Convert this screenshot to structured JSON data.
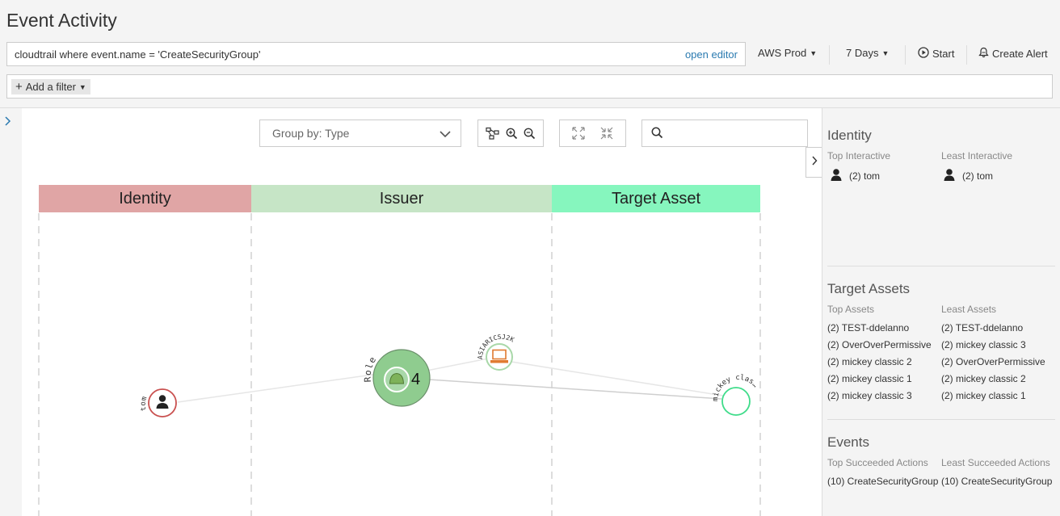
{
  "page_title": "Event Activity",
  "query": {
    "text": "cloudtrail where event.name = 'CreateSecurityGroup'",
    "open_editor": "open editor"
  },
  "toolbar": {
    "account": "AWS Prod",
    "range": "7 Days",
    "start": "Start",
    "create_alert": "Create Alert"
  },
  "filter": {
    "add_label": "Add a filter"
  },
  "graph_controls": {
    "groupby_label": "Group by: Type"
  },
  "columns": [
    {
      "label": "Identity",
      "color": "#e0a5a5"
    },
    {
      "label": "Issuer",
      "color": "#c6e5c6"
    },
    {
      "label": "Target Asset",
      "color": "#86f6be"
    }
  ],
  "nodes": {
    "tom": {
      "label": "tom"
    },
    "role": {
      "label": "Role",
      "count": "4"
    },
    "asia": {
      "label": "ASIARICSJ2K"
    },
    "mickey": {
      "label": "mickey clas…"
    }
  },
  "panel": {
    "identity": {
      "title": "Identity",
      "top_label": "Top Interactive",
      "least_label": "Least Interactive",
      "top": [
        "(2) tom"
      ],
      "least": [
        "(2) tom"
      ]
    },
    "targets": {
      "title": "Target Assets",
      "top_label": "Top Assets",
      "least_label": "Least Assets",
      "top": [
        "(2) TEST-ddelanno",
        "(2) OverOverPermissive",
        "(2) mickey classic 2",
        "(2) mickey classic 1",
        "(2) mickey classic 3"
      ],
      "least": [
        "(2) TEST-ddelanno",
        "(2) mickey classic 3",
        "(2) OverOverPermissive",
        "(2) mickey classic 2",
        "(2) mickey classic 1"
      ]
    },
    "events": {
      "title": "Events",
      "top_label": "Top Succeeded Actions",
      "least_label": "Least Succeeded Actions",
      "top": [
        "(10) CreateSecurityGroup"
      ],
      "least": [
        "(10) CreateSecurityGroup"
      ]
    }
  },
  "colors": {
    "link": "#2a7ab0",
    "identity_node": "#c9504f",
    "role_node": "#8fcc8f",
    "asset_node": "#3fdc8a"
  }
}
